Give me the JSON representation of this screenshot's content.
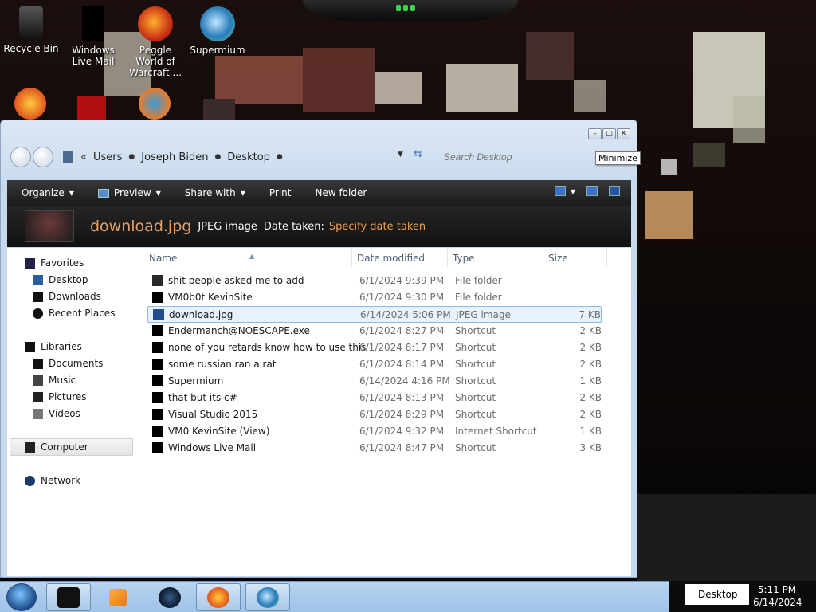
{
  "desktop": {
    "icons": [
      {
        "label": "Recycle Bin"
      },
      {
        "label": "Windows Live Mail"
      },
      {
        "label": "Peggle World of Warcraft ..."
      },
      {
        "label": "Supermium"
      }
    ]
  },
  "tooltip": "Minimize",
  "explorer": {
    "breadcrumb": [
      "Users",
      "Joseph Biden",
      "Desktop"
    ],
    "breadcrumb_overflow": "«",
    "search_placeholder": "Search Desktop",
    "toolbar": {
      "organize": "Organize",
      "preview": "Preview",
      "share_with": "Share with",
      "print": "Print",
      "new_folder": "New folder"
    },
    "details_pane": {
      "file_name": "download.jpg",
      "file_type": "JPEG image",
      "date_label": "Date taken:",
      "date_value": "Specify date taken"
    },
    "nav": {
      "favorites": "Favorites",
      "desktop": "Desktop",
      "downloads": "Downloads",
      "recent_places": "Recent Places",
      "libraries": "Libraries",
      "documents": "Documents",
      "music": "Music",
      "pictures": "Pictures",
      "videos": "Videos",
      "computer": "Computer",
      "network": "Network"
    },
    "columns": {
      "name": "Name",
      "date_modified": "Date modified",
      "type": "Type",
      "size": "Size"
    },
    "files": [
      {
        "name": "shit people asked me to add",
        "date": "6/1/2024 9:39 PM",
        "type": "File folder",
        "size": ""
      },
      {
        "name": "VM0b0t KevinSite",
        "date": "6/1/2024 9:30 PM",
        "type": "File folder",
        "size": ""
      },
      {
        "name": "download.jpg",
        "date": "6/14/2024 5:06 PM",
        "type": "JPEG image",
        "size": "7 KB"
      },
      {
        "name": "Endermanch@NOESCAPE.exe",
        "date": "6/1/2024 8:27 PM",
        "type": "Shortcut",
        "size": "2 KB"
      },
      {
        "name": "none of you retards know how to use this",
        "date": "6/1/2024 8:17 PM",
        "type": "Shortcut",
        "size": "2 KB"
      },
      {
        "name": "some russian ran a rat",
        "date": "6/1/2024 8:14 PM",
        "type": "Shortcut",
        "size": "2 KB"
      },
      {
        "name": "Supermium",
        "date": "6/14/2024 4:16 PM",
        "type": "Shortcut",
        "size": "1 KB"
      },
      {
        "name": "that but its c#",
        "date": "6/1/2024 8:13 PM",
        "type": "Shortcut",
        "size": "2 KB"
      },
      {
        "name": "Visual Studio 2015",
        "date": "6/1/2024 8:29 PM",
        "type": "Shortcut",
        "size": "2 KB"
      },
      {
        "name": "VM0 KevinSite (View)",
        "date": "6/1/2024 9:32 PM",
        "type": "Internet Shortcut",
        "size": "1 KB"
      },
      {
        "name": "Windows Live Mail",
        "date": "6/1/2024 8:47 PM",
        "type": "Shortcut",
        "size": "3 KB"
      }
    ]
  },
  "taskbar": {
    "desktop_chip": "Desktop",
    "time": "5:11 PM",
    "date": "6/14/2024"
  },
  "colors": {
    "accent": "#3a73b8",
    "selection": "#e8f2fd",
    "details_name": "#e3a06a",
    "details_value": "#f0a04a"
  }
}
